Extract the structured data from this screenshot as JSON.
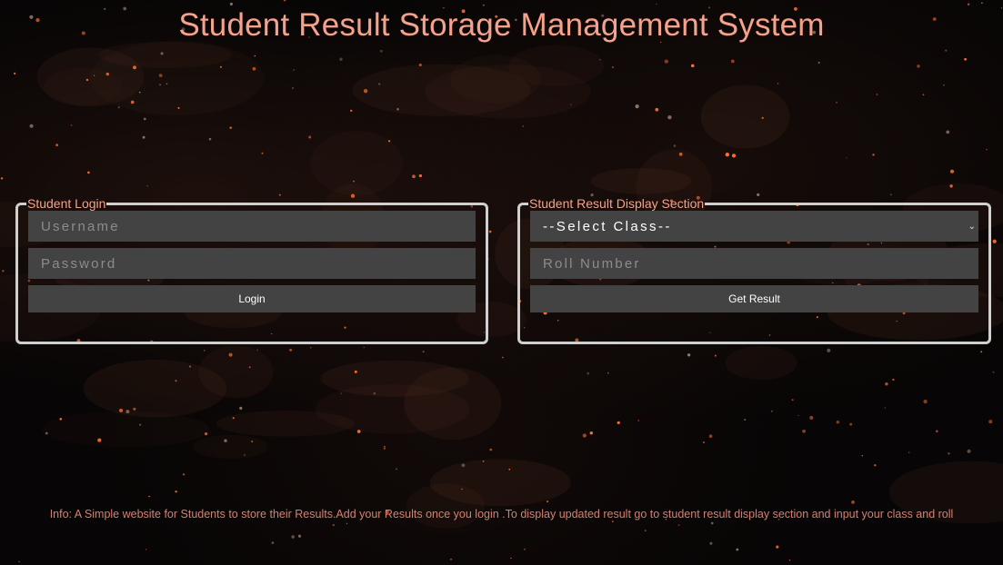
{
  "page": {
    "title": "Student Result Storage Management System"
  },
  "login_section": {
    "legend": "Student Login",
    "username_placeholder": "Username",
    "password_placeholder": "Password",
    "login_button": "Login"
  },
  "result_section": {
    "legend": "Student Result Display Section",
    "class_select_value": "--Select Class--",
    "roll_placeholder": "Roll Number",
    "get_result_button": "Get Result"
  },
  "footer": {
    "info": "Info: A Simple website for Students to store their Results.Add your Results once you login .To display updated result go to student result display section and input your class and roll"
  },
  "colors": {
    "accent_text": "#f4a28c",
    "panel_border": "#cfcfcf",
    "field_background": "#434343",
    "page_background": "#070505"
  }
}
